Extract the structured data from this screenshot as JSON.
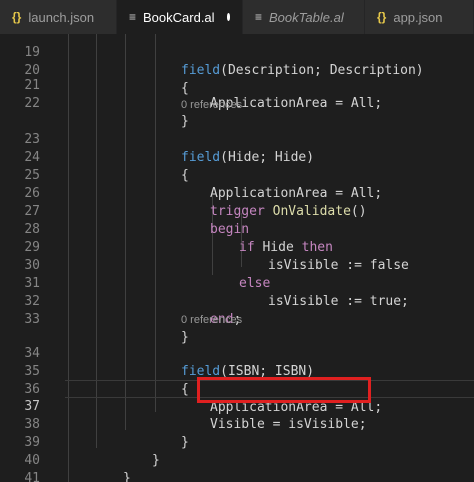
{
  "tabs": [
    {
      "icon": "{}",
      "label": "launch.json"
    },
    {
      "icon": "≡",
      "label": "BookCard.al",
      "modified": true
    },
    {
      "icon": "≡",
      "label": "BookTable.al"
    },
    {
      "icon": "{}",
      "label": "app.json"
    }
  ],
  "codelens": {
    "refs_1": "0 references",
    "refs_2": "0 references"
  },
  "lines": {
    "l19": {
      "num": "19",
      "kw": "field",
      "rest": "(Description; Description)"
    },
    "l20": {
      "num": "20",
      "text": "{"
    },
    "l21": {
      "num": "21",
      "text": "ApplicationArea = All;"
    },
    "l22": {
      "num": "22",
      "text": "}"
    },
    "l23": {
      "num": "23",
      "kw": "field",
      "rest": "(Hide; Hide)"
    },
    "l24": {
      "num": "24",
      "text": "{"
    },
    "l25": {
      "num": "25",
      "text": "ApplicationArea = All;"
    },
    "l26": {
      "num": "26",
      "kw": "trigger",
      "fn": "OnValidate",
      "rest": "()"
    },
    "l27": {
      "num": "27",
      "kw": "begin"
    },
    "l28": {
      "num": "28",
      "kw": "if",
      "mid": " Hide ",
      "kw_b": "then"
    },
    "l29": {
      "num": "29",
      "text": "isVisible := false"
    },
    "l30": {
      "num": "30",
      "kw": "else"
    },
    "l31": {
      "num": "31",
      "text": "isVisible := true;"
    },
    "l32": {
      "num": "32",
      "kw": "end",
      "rest": ";"
    },
    "l33": {
      "num": "33",
      "text": "}"
    },
    "l34": {
      "num": "34",
      "kw": "field",
      "rest": "(ISBN; ISBN)"
    },
    "l35": {
      "num": "35",
      "text": "{"
    },
    "l36": {
      "num": "36",
      "text": "ApplicationArea = All;"
    },
    "l37": {
      "num": "37",
      "text": "Visible = isVisible;"
    },
    "l38": {
      "num": "38",
      "text": "}"
    },
    "l39": {
      "num": "39",
      "text": "}"
    },
    "l40": {
      "num": "40",
      "text": "}"
    },
    "l41": {
      "num": "41",
      "text": "}"
    }
  },
  "colors": {
    "keyword": "#569cd6",
    "control": "#c586c0",
    "function": "#dcdcaa",
    "highlight": "#e02020"
  }
}
